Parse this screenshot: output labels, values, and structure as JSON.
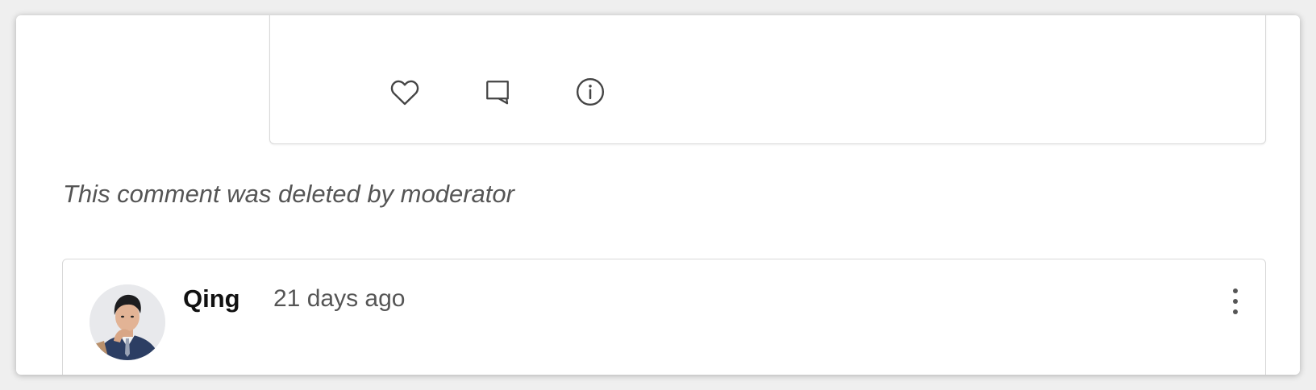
{
  "reply_card": {
    "actions": [
      {
        "icon": "heart-icon",
        "label": "like"
      },
      {
        "icon": "comment-icon",
        "label": "comment"
      },
      {
        "icon": "info-icon",
        "label": "info"
      }
    ]
  },
  "deleted_comment": {
    "text": "This comment was deleted by moderator"
  },
  "comment": {
    "author": "Qing",
    "timestamp": "21 days ago",
    "avatar_icon": "user-avatar",
    "menu_icon": "more-vertical-icon"
  },
  "colors": {
    "icon": "#444444",
    "muted_text": "#555555",
    "border": "#d9d9d9"
  }
}
